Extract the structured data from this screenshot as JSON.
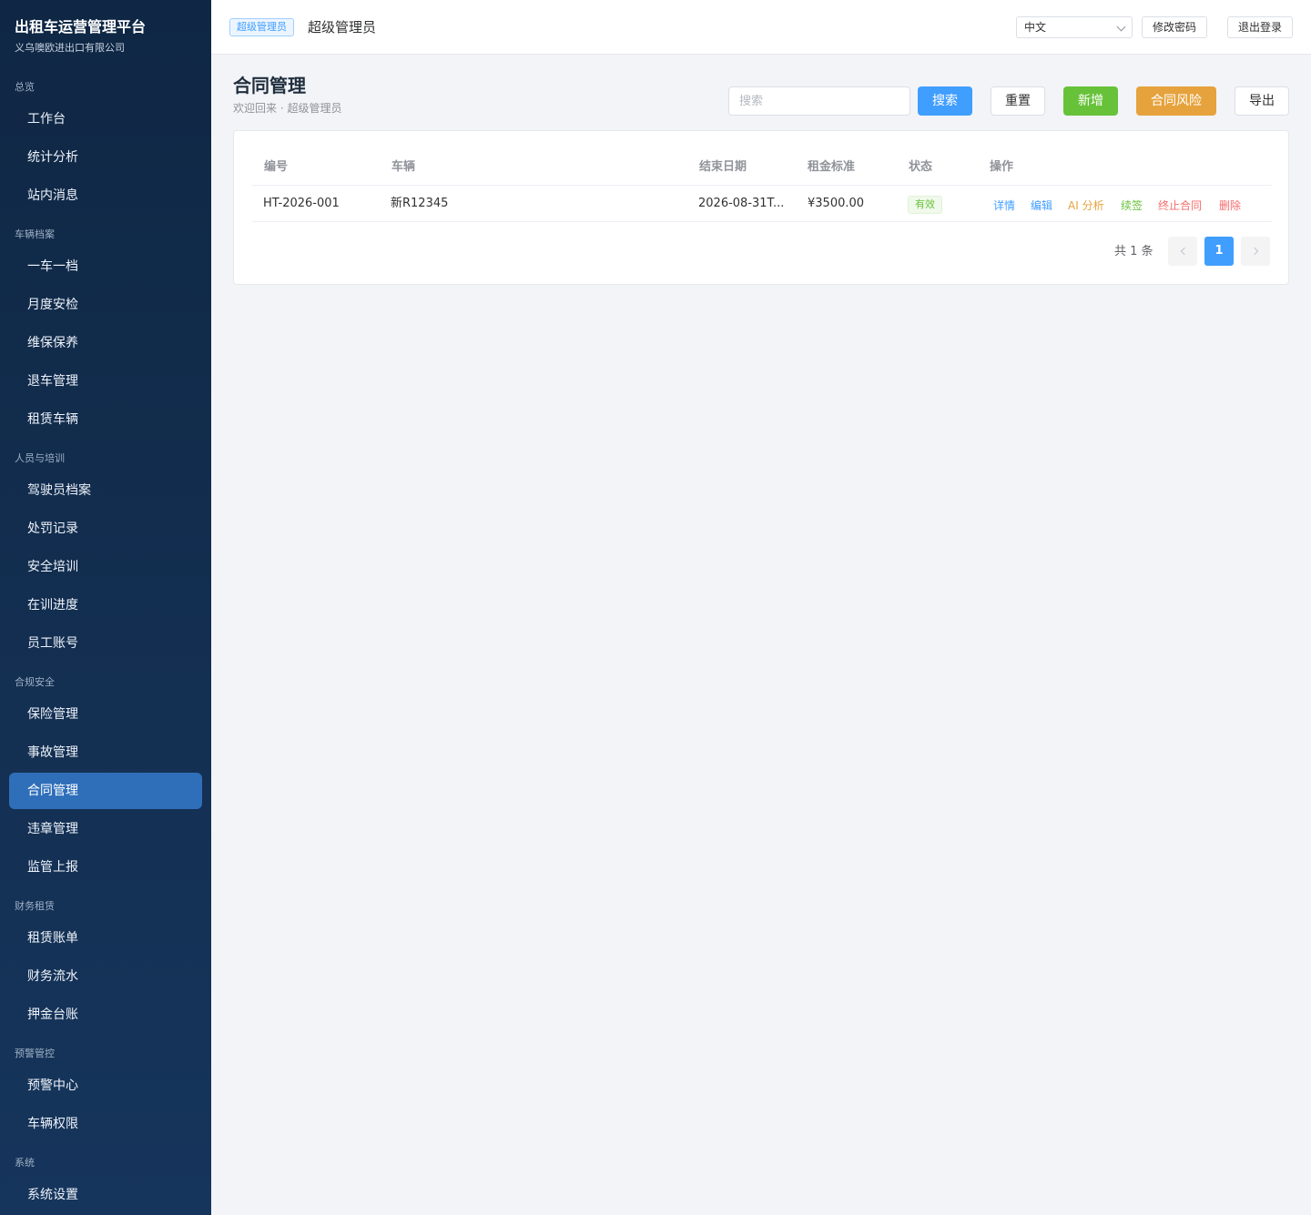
{
  "sidebar": {
    "brand_title": "出租车运营管理平台",
    "brand_sub": "义乌噢欧进出口有限公司",
    "groups": [
      "总览",
      "车辆档案",
      "人员与培训",
      "合规安全",
      "财务租赁",
      "预警管控",
      "系统"
    ],
    "items": [
      "工作台",
      "统计分析",
      "站内消息",
      "一车一档",
      "月度安检",
      "维保保养",
      "退车管理",
      "租赁车辆",
      "驾驶员档案",
      "处罚记录",
      "安全培训",
      "在训进度",
      "员工账号",
      "保险管理",
      "事故管理",
      "合同管理",
      "违章管理",
      "监管上报",
      "租赁账单",
      "财务流水",
      "押金台账",
      "预警中心",
      "车辆权限",
      "系统设置"
    ],
    "active_item": "合同管理"
  },
  "header": {
    "role_tag": "超级管理员",
    "user_name": "超级管理员",
    "language": "中文",
    "change_password": "修改密码",
    "logout": "退出登录"
  },
  "page": {
    "title": "合同管理",
    "subtitle": "欢迎回来 · 超级管理员",
    "search_placeholder": "搜索",
    "buttons": {
      "search": "搜索",
      "reset": "重置",
      "add": "新增",
      "risk": "合同风险",
      "export": "导出"
    }
  },
  "table": {
    "columns": [
      "编号",
      "车辆",
      "结束日期",
      "租金标准",
      "状态",
      "操作"
    ],
    "rows": [
      {
        "no": "HT-2026-001",
        "vehicle": "新R12345",
        "end_date": "2026-08-31T...",
        "rent": "¥3500.00",
        "status": "有效",
        "actions": [
          "详情",
          "编辑",
          "AI 分析",
          "续签",
          "终止合同",
          "删除"
        ]
      }
    ]
  },
  "pagination": {
    "total_text": "共 1 条",
    "current_page": "1"
  },
  "colors": {
    "primary": "#409eff",
    "success": "#67c23a",
    "warning": "#e6a23c",
    "danger": "#f56c6c",
    "sidebar_active": "#2f6fba"
  }
}
